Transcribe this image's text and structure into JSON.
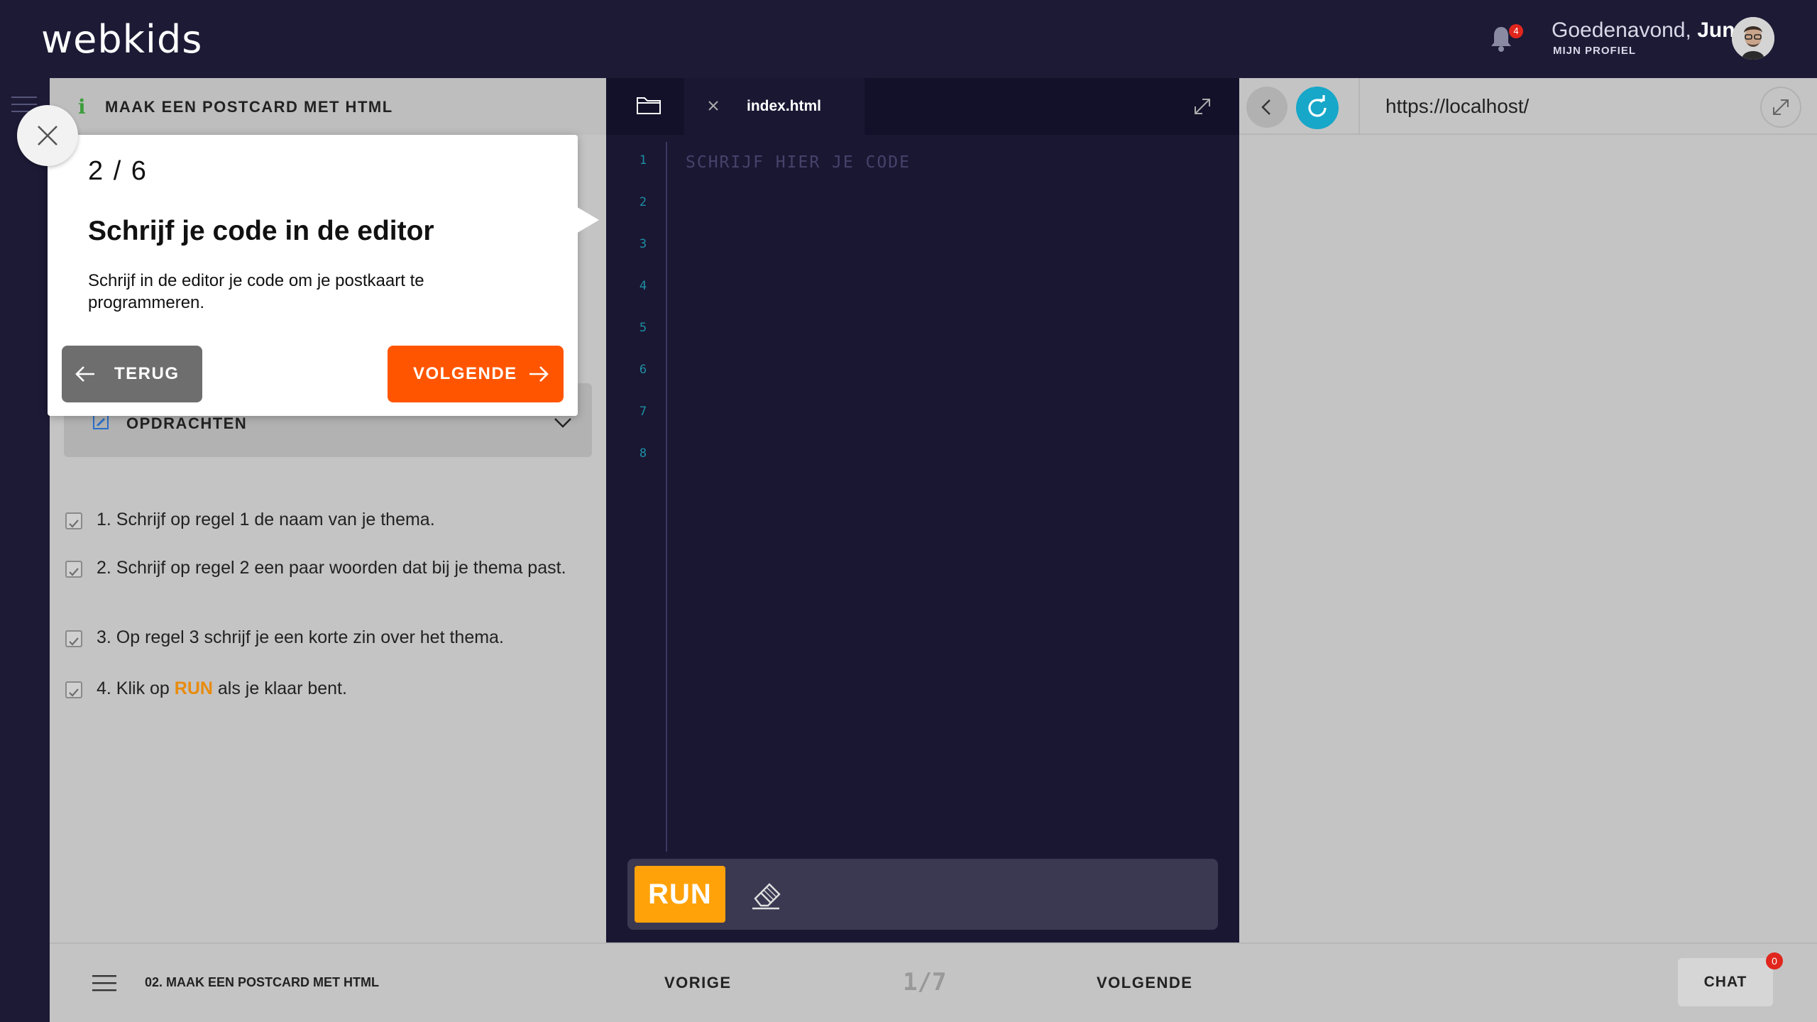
{
  "header": {
    "logo": "webkids",
    "notification_count": "4",
    "greeting_prefix": "Goedenavond,",
    "user_name": "Jun",
    "profile_link": "MIJN PROFIEL"
  },
  "lesson_panel": {
    "title": "MAAK EEN POSTCARD MET HTML",
    "opdrachten_label": "OPDRACHTEN",
    "tasks": [
      {
        "text": "1. Schrijf op regel 1 de naam van je thema."
      },
      {
        "text": "2. Schrijf op regel 2 een paar woorden dat bij je thema past."
      },
      {
        "text": "3. Op regel 3 schrijf je een korte zin over het thema."
      },
      {
        "prefix": "4. Klik op ",
        "highlight": "RUN",
        "suffix": " als je klaar bent."
      }
    ]
  },
  "editor": {
    "tab_label": "index.html",
    "placeholder": "SCHRIJF HIER JE CODE",
    "line_numbers": [
      "1",
      "2",
      "3",
      "4",
      "5",
      "6",
      "7",
      "8"
    ],
    "run_label": "RUN"
  },
  "preview": {
    "url": "https://localhost/"
  },
  "footer": {
    "lesson_title": "02. MAAK EEN POSTCARD MET HTML",
    "prev_label": "VORIGE",
    "page_counter": "1/7",
    "next_label": "VOLGENDE",
    "chat_label": "CHAT",
    "chat_count": "0"
  },
  "tutorial": {
    "step": "2 / 6",
    "title": "Schrijf je code in de editor",
    "body": "Schrijf in de editor je code om je postkaart te programmeren.",
    "back_label": "TERUG",
    "next_label": "VOLGENDE"
  },
  "colors": {
    "run_accent": "#ffa20a",
    "next_button": "#ff5500",
    "reload_button": "#16a7c9",
    "background_dark": "#1a1733"
  },
  "icons": [
    "bell-icon",
    "avatar",
    "menu-icon",
    "info-icon",
    "clipboard-icon",
    "chevron-down-icon",
    "folder-icon",
    "close-icon",
    "expand-icon",
    "eraser-icon",
    "arrow-left-icon",
    "reload-icon",
    "arrow-right-icon"
  ]
}
